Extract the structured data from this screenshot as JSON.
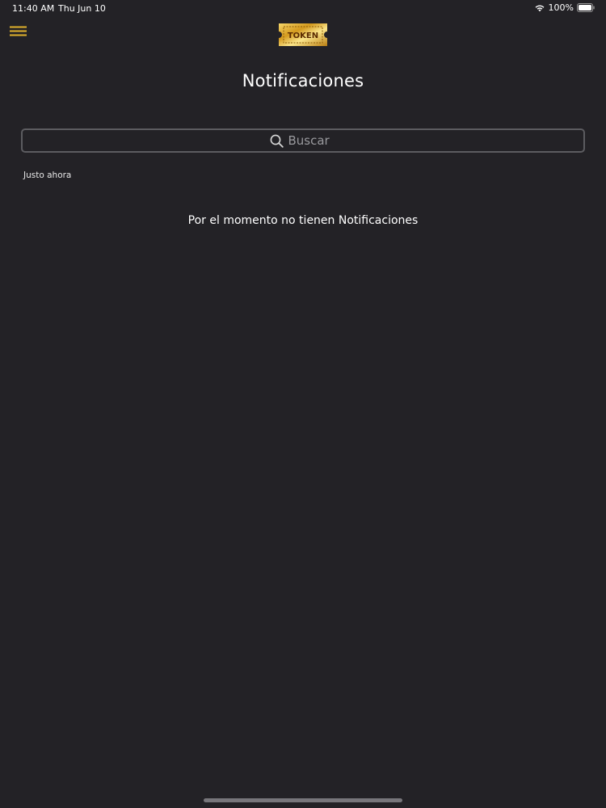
{
  "status_bar": {
    "time": "11:40 AM",
    "date": "Thu Jun 10",
    "battery": "100%",
    "wifi_icon": "wifi-icon",
    "battery_icon": "battery-icon"
  },
  "header": {
    "menu_icon": "hamburger-menu-icon",
    "logo_text": "TOKEN",
    "accent_color": "#e0b12c"
  },
  "page": {
    "title": "Notificaciones"
  },
  "search": {
    "placeholder": "Buscar",
    "value": "",
    "icon": "search-icon"
  },
  "notifications": {
    "timestamp": "Justo ahora",
    "empty_message": "Por el momento no tienen Notificaciones"
  }
}
